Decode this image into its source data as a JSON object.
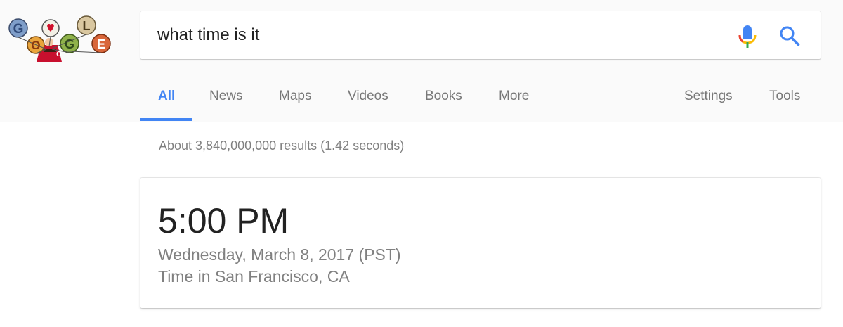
{
  "search": {
    "query": "what time is it"
  },
  "doodle": {
    "letters": [
      "G",
      "O",
      "O",
      "G",
      "L",
      "E"
    ],
    "icon": "google-doodle-logo"
  },
  "tabs": [
    {
      "label": "All",
      "active": true
    },
    {
      "label": "News",
      "active": false
    },
    {
      "label": "Maps",
      "active": false
    },
    {
      "label": "Videos",
      "active": false
    },
    {
      "label": "Books",
      "active": false
    },
    {
      "label": "More",
      "active": false
    }
  ],
  "tools": {
    "settings_label": "Settings",
    "tools_label": "Tools"
  },
  "results": {
    "stats": "About 3,840,000,000 results (1.42 seconds)"
  },
  "time_card": {
    "time": "5:00 PM",
    "date": "Wednesday, March 8, 2017 (PST)",
    "location": "Time in San Francisco, CA"
  },
  "colors": {
    "accent_blue": "#4285f4",
    "mic_red": "#ea4335",
    "mic_yellow": "#fbbc05",
    "mic_green": "#34a853"
  }
}
